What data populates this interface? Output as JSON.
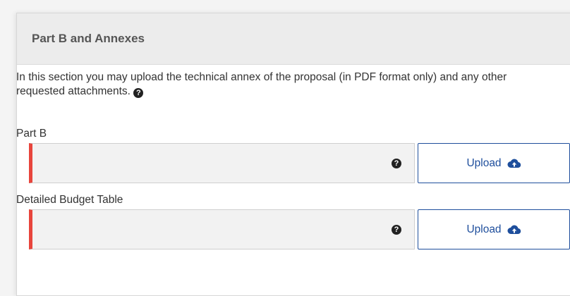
{
  "panel": {
    "title": "Part B and Annexes",
    "intro": "In this section you may upload the technical annex of the proposal (in PDF format only) and any other requested attachments."
  },
  "fields": [
    {
      "label": "Part B",
      "file_value": "",
      "upload_label": "Upload",
      "required": true
    },
    {
      "label": "Detailed Budget Table",
      "file_value": "",
      "upload_label": "Upload",
      "required": true
    }
  ],
  "icons": {
    "help": "question-circle-icon",
    "upload": "cloud-upload-icon"
  },
  "colors": {
    "required_marker": "#e8453c",
    "primary": "#1e4e9c"
  }
}
